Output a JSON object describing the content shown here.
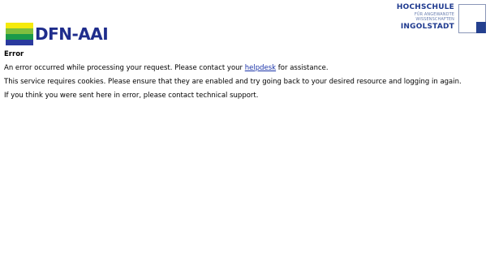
{
  "header": {
    "dfn_logo_text": "DFN-AAI",
    "dfn_stripe_colors": [
      "#f5ea0c",
      "#7fbf3f",
      "#1a9a4a",
      "#2a3a9e"
    ],
    "thi_logo": {
      "line1": "HOCHSCHULE",
      "line2": "FÜR ANGEWANDTE",
      "line3": "WISSENSCHAFTEN",
      "line4": "INGOLSTADT"
    }
  },
  "main": {
    "title": "Error",
    "message_before_link": "An error occurred while processing your request. Please contact your ",
    "helpdesk_link": "helpdesk",
    "message_after_link": " for assistance.",
    "cookies_text": "This service requires cookies. Please ensure that they are enabled and try going back to your desired resource and logging in again.",
    "support_text": "If you think you were sent here in error, please contact technical support."
  }
}
